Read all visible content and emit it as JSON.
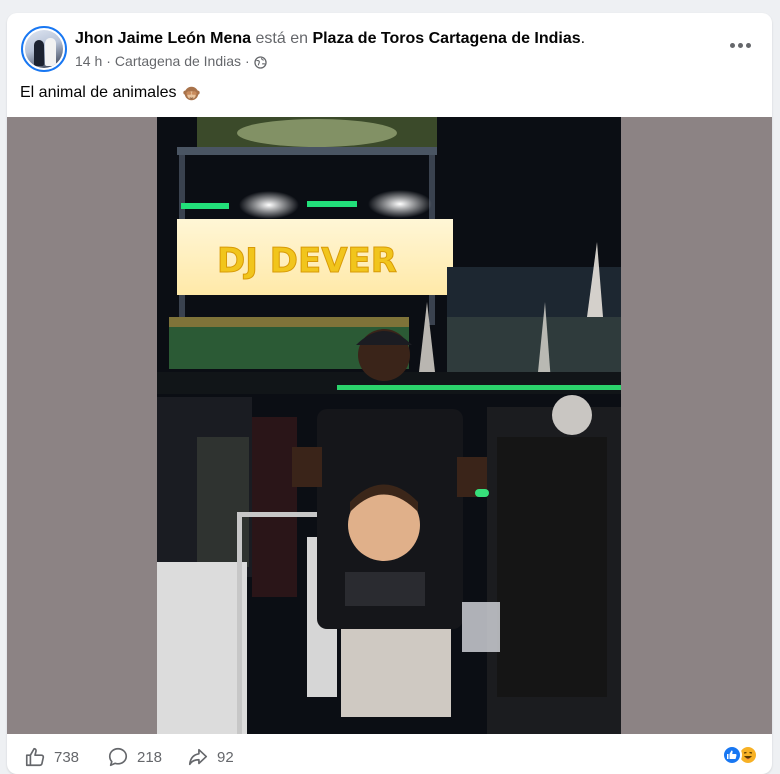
{
  "post": {
    "author": "Jhon Jaime León Mena",
    "connector": "está en",
    "place": "Plaza de Toros Cartagena de Indias",
    "period": ".",
    "time": "14 h",
    "location": "Cartagena de Indias",
    "dot": "·",
    "caption": "El animal de animales",
    "caption_emoji": "see-no-evil-monkey",
    "privacy_icon": "globe-icon"
  },
  "photo": {
    "stage_banner": "DJ DEVER"
  },
  "footer": {
    "likes": "738",
    "comments": "218",
    "shares": "92",
    "reactions": [
      "like",
      "haha"
    ]
  },
  "colors": {
    "brand_blue": "#1877f2",
    "muted_text": "#65676b",
    "letterbox": "#8c8384",
    "haha_yellow": "#f7b125"
  }
}
